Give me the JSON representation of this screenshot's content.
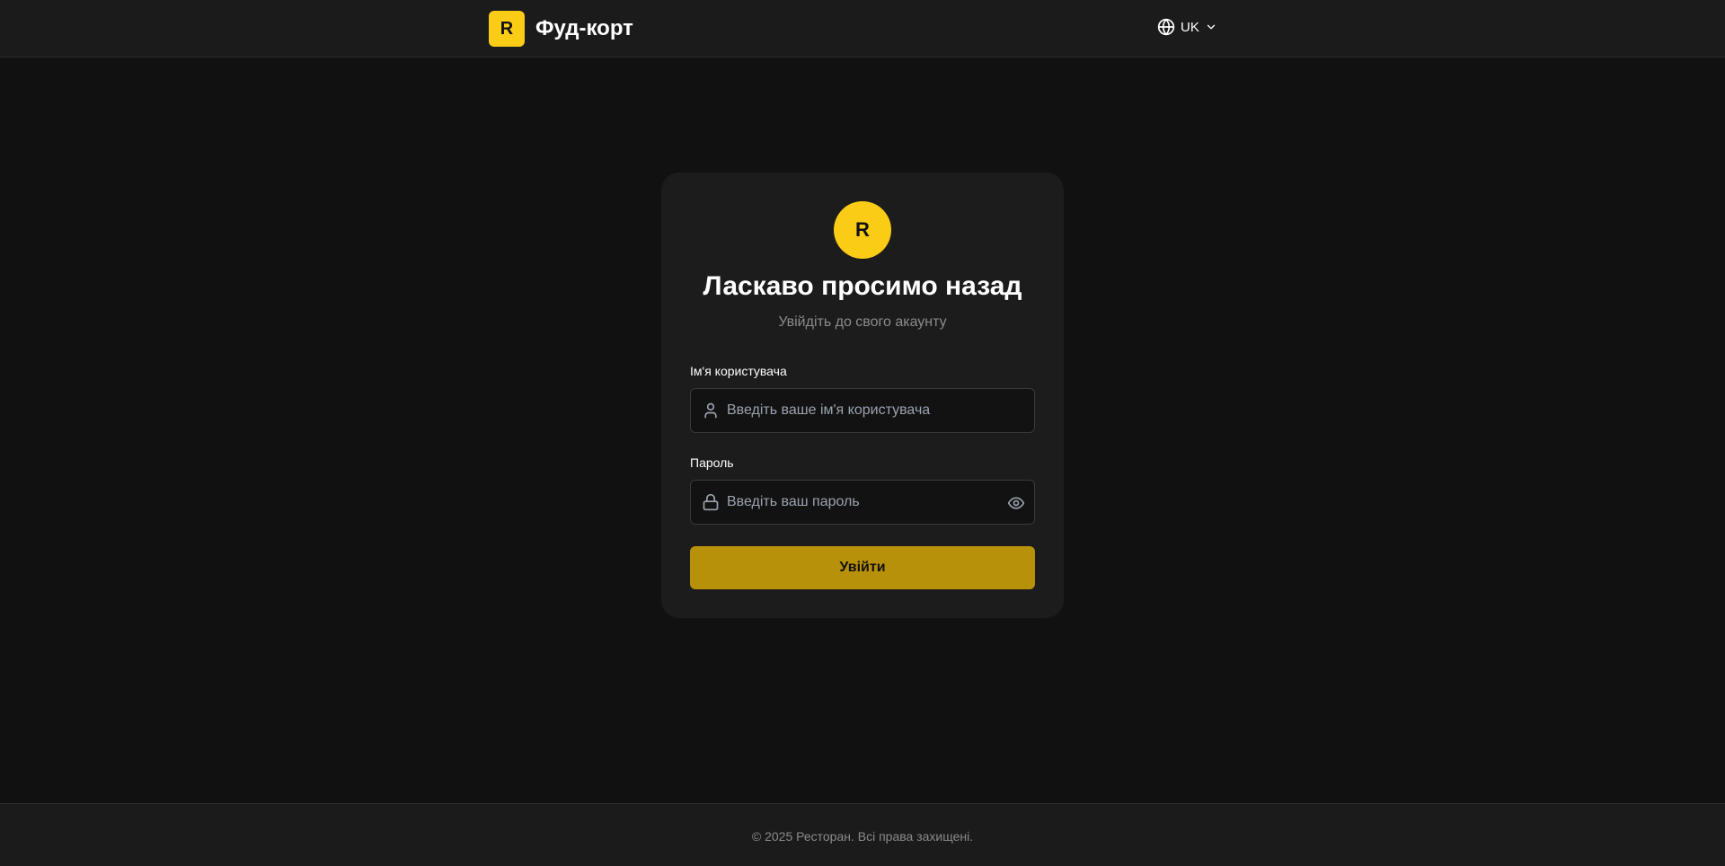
{
  "header": {
    "logo_letter": "R",
    "brand_name": "Фуд-корт",
    "language": {
      "label": "UK",
      "icon": "globe-icon",
      "chevron_icon": "chevron-down-icon"
    }
  },
  "login": {
    "logo_letter": "R",
    "title": "Ласкаво просимо назад",
    "subtitle": "Увійдіть до свого акаунту",
    "username": {
      "label": "Ім'я користувача",
      "placeholder": "Введіть ваше ім'я користувача",
      "value": "",
      "icon": "user-icon"
    },
    "password": {
      "label": "Пароль",
      "placeholder": "Введіть ваш пароль",
      "value": "",
      "icon": "lock-icon",
      "toggle_icon": "eye-icon"
    },
    "submit_label": "Увійти"
  },
  "footer": {
    "text": "© 2025 Ресторан. Всі права захищені."
  },
  "colors": {
    "background": "#111111",
    "header_bg": "#1b1b1b",
    "card_bg": "#1c1c1c",
    "accent": "#facc15",
    "button": "#b8910b",
    "muted_text": "#8b8b8b"
  }
}
